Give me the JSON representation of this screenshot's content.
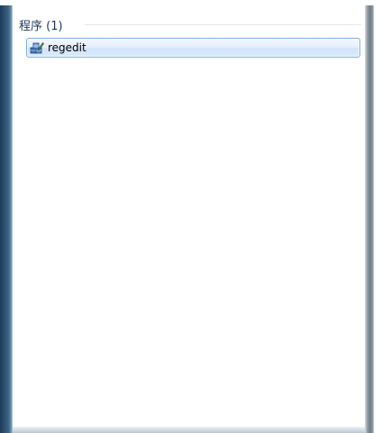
{
  "search_results": {
    "group_title": "程序 (1)",
    "items": [
      {
        "label": "regedit",
        "icon": "registry-editor-icon"
      }
    ]
  },
  "colors": {
    "group_title": "#1e395b",
    "selection_border": "#84acdd",
    "selection_fill": "#dce9fa"
  }
}
